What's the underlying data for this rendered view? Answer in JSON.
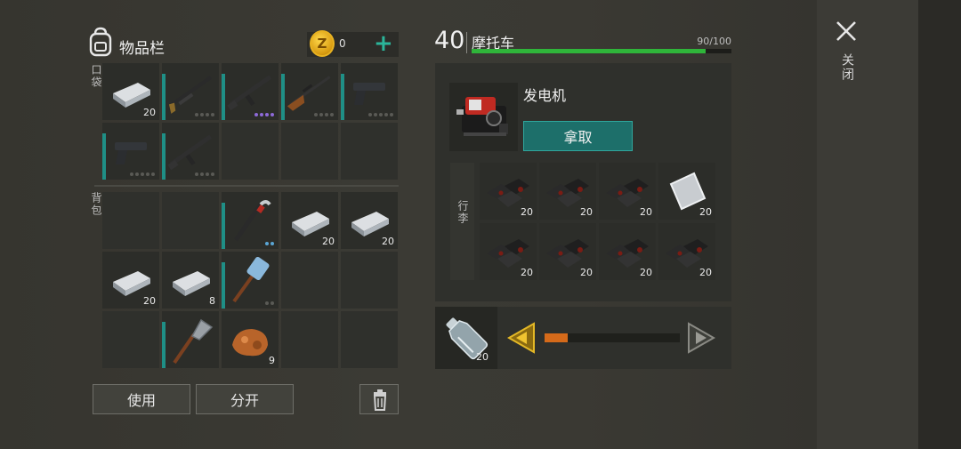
{
  "inventory": {
    "title": "物品栏",
    "coins": "0",
    "pockets_label": "口袋",
    "backpack_label": "背包",
    "pockets": [
      {
        "item": "iron-bar",
        "count": "20"
      },
      {
        "item": "shotgun",
        "dots": 4
      },
      {
        "item": "assault-rifle",
        "dots": 4,
        "special": true
      },
      {
        "item": "hunting-rifle",
        "dots": 4
      },
      {
        "item": "pistol",
        "dots": 5
      },
      {
        "item": "pistol",
        "dots": 5
      },
      {
        "item": "assault-rifle",
        "dots": 4
      },
      {
        "item": null
      },
      {
        "item": null
      },
      {
        "item": null
      }
    ],
    "backpack": [
      {
        "item": null
      },
      {
        "item": null
      },
      {
        "item": "crowbar",
        "dots": 2,
        "blue": true
      },
      {
        "item": "iron-bar",
        "count": "20"
      },
      {
        "item": "iron-bar",
        "count": "20"
      },
      {
        "item": "iron-bar",
        "count": "20"
      },
      {
        "item": "iron-bar",
        "count": "8"
      },
      {
        "item": "sledgehammer",
        "dots": 2
      },
      {
        "item": null
      },
      {
        "item": null
      },
      {
        "item": null
      },
      {
        "item": "shovel"
      },
      {
        "item": "copper-ore",
        "count": "9"
      },
      {
        "item": null
      },
      {
        "item": null
      }
    ],
    "use_button": "使用",
    "split_button": "分开"
  },
  "vehicle": {
    "level": "40",
    "name": "摩托车",
    "hp_text": "90/100",
    "hp_fraction": 0.9,
    "generator_name": "发电机",
    "take_button": "拿取",
    "cargo_label": "行李",
    "cargo": [
      {
        "item": "coal",
        "count": "20"
      },
      {
        "item": "coal",
        "count": "20"
      },
      {
        "item": "coal",
        "count": "20"
      },
      {
        "item": "iron-plate",
        "count": "20"
      },
      {
        "item": "coal",
        "count": "20"
      },
      {
        "item": "coal",
        "count": "20"
      },
      {
        "item": "coal",
        "count": "20"
      },
      {
        "item": "coal",
        "count": "20"
      }
    ]
  },
  "fuel": {
    "item": "plastic-bottle",
    "count": "20",
    "slider_fraction": 0.17
  },
  "close": {
    "label": "关闭"
  },
  "colors": {
    "accent": "#1d6f6a",
    "hp": "#2fb53a",
    "slider": "#d56a1a",
    "durability": "#1f8f86"
  }
}
